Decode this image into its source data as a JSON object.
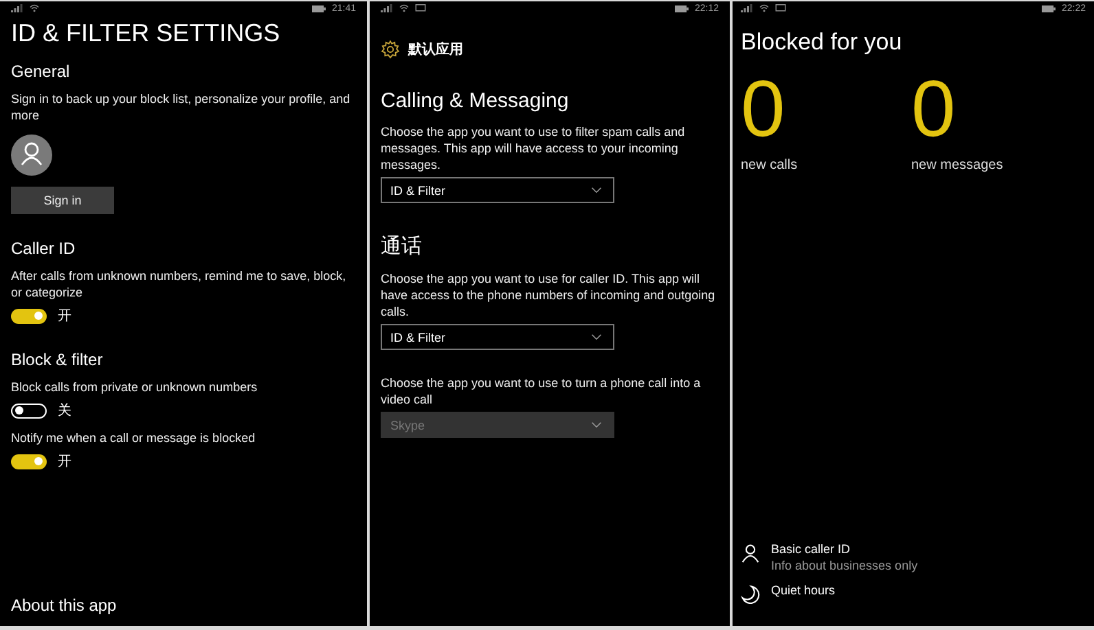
{
  "settings_screen": {
    "status_bar": {
      "time": "21:41",
      "message_icon": false
    },
    "title": "ID & FILTER SETTINGS",
    "general": {
      "heading": "General",
      "description": "Sign in to back up your block list, personalize your profile, and more",
      "sign_in_button": "Sign in"
    },
    "caller_id": {
      "heading": "Caller ID",
      "toggles": [
        {
          "description": "After calls from unknown numbers, remind me to save, block, or categorize",
          "on": true,
          "state_label": "开"
        }
      ]
    },
    "block_filter": {
      "heading": "Block & filter",
      "toggles": [
        {
          "description": "Block calls from private or unknown numbers",
          "on": false,
          "state_label": "关"
        },
        {
          "description": "Notify me when a call or message is blocked",
          "on": true,
          "state_label": "开"
        }
      ]
    },
    "about_link": "About this app"
  },
  "default_apps_screen": {
    "status_bar": {
      "time": "22:12",
      "message_icon": true
    },
    "header": "默认应用",
    "sections": [
      {
        "heading": "Calling & Messaging",
        "description": "Choose the app you want to use to filter spam calls and messages. This app will have access to your incoming messages.",
        "dropdown": {
          "value": "ID & Filter",
          "disabled": false
        }
      },
      {
        "heading": "通话",
        "description": "Choose the app you want to use for caller ID. This app will have access to the phone numbers of incoming and outgoing calls.",
        "dropdown": {
          "value": "ID & Filter",
          "disabled": false
        }
      },
      {
        "description": "Choose the app you want to use to turn a phone call into a video call",
        "dropdown": {
          "value": "Skype",
          "disabled": true
        }
      }
    ]
  },
  "blocked_screen": {
    "status_bar": {
      "time": "22:22",
      "message_icon": true
    },
    "title": "Blocked for you",
    "counters": [
      {
        "count": "0",
        "label": "new calls"
      },
      {
        "count": "0",
        "label": "new messages"
      }
    ],
    "items": [
      {
        "kind": "person",
        "title": "Basic caller ID",
        "subtitle": "Info about businesses only"
      },
      {
        "kind": "moon",
        "title": "Quiet hours"
      }
    ]
  }
}
